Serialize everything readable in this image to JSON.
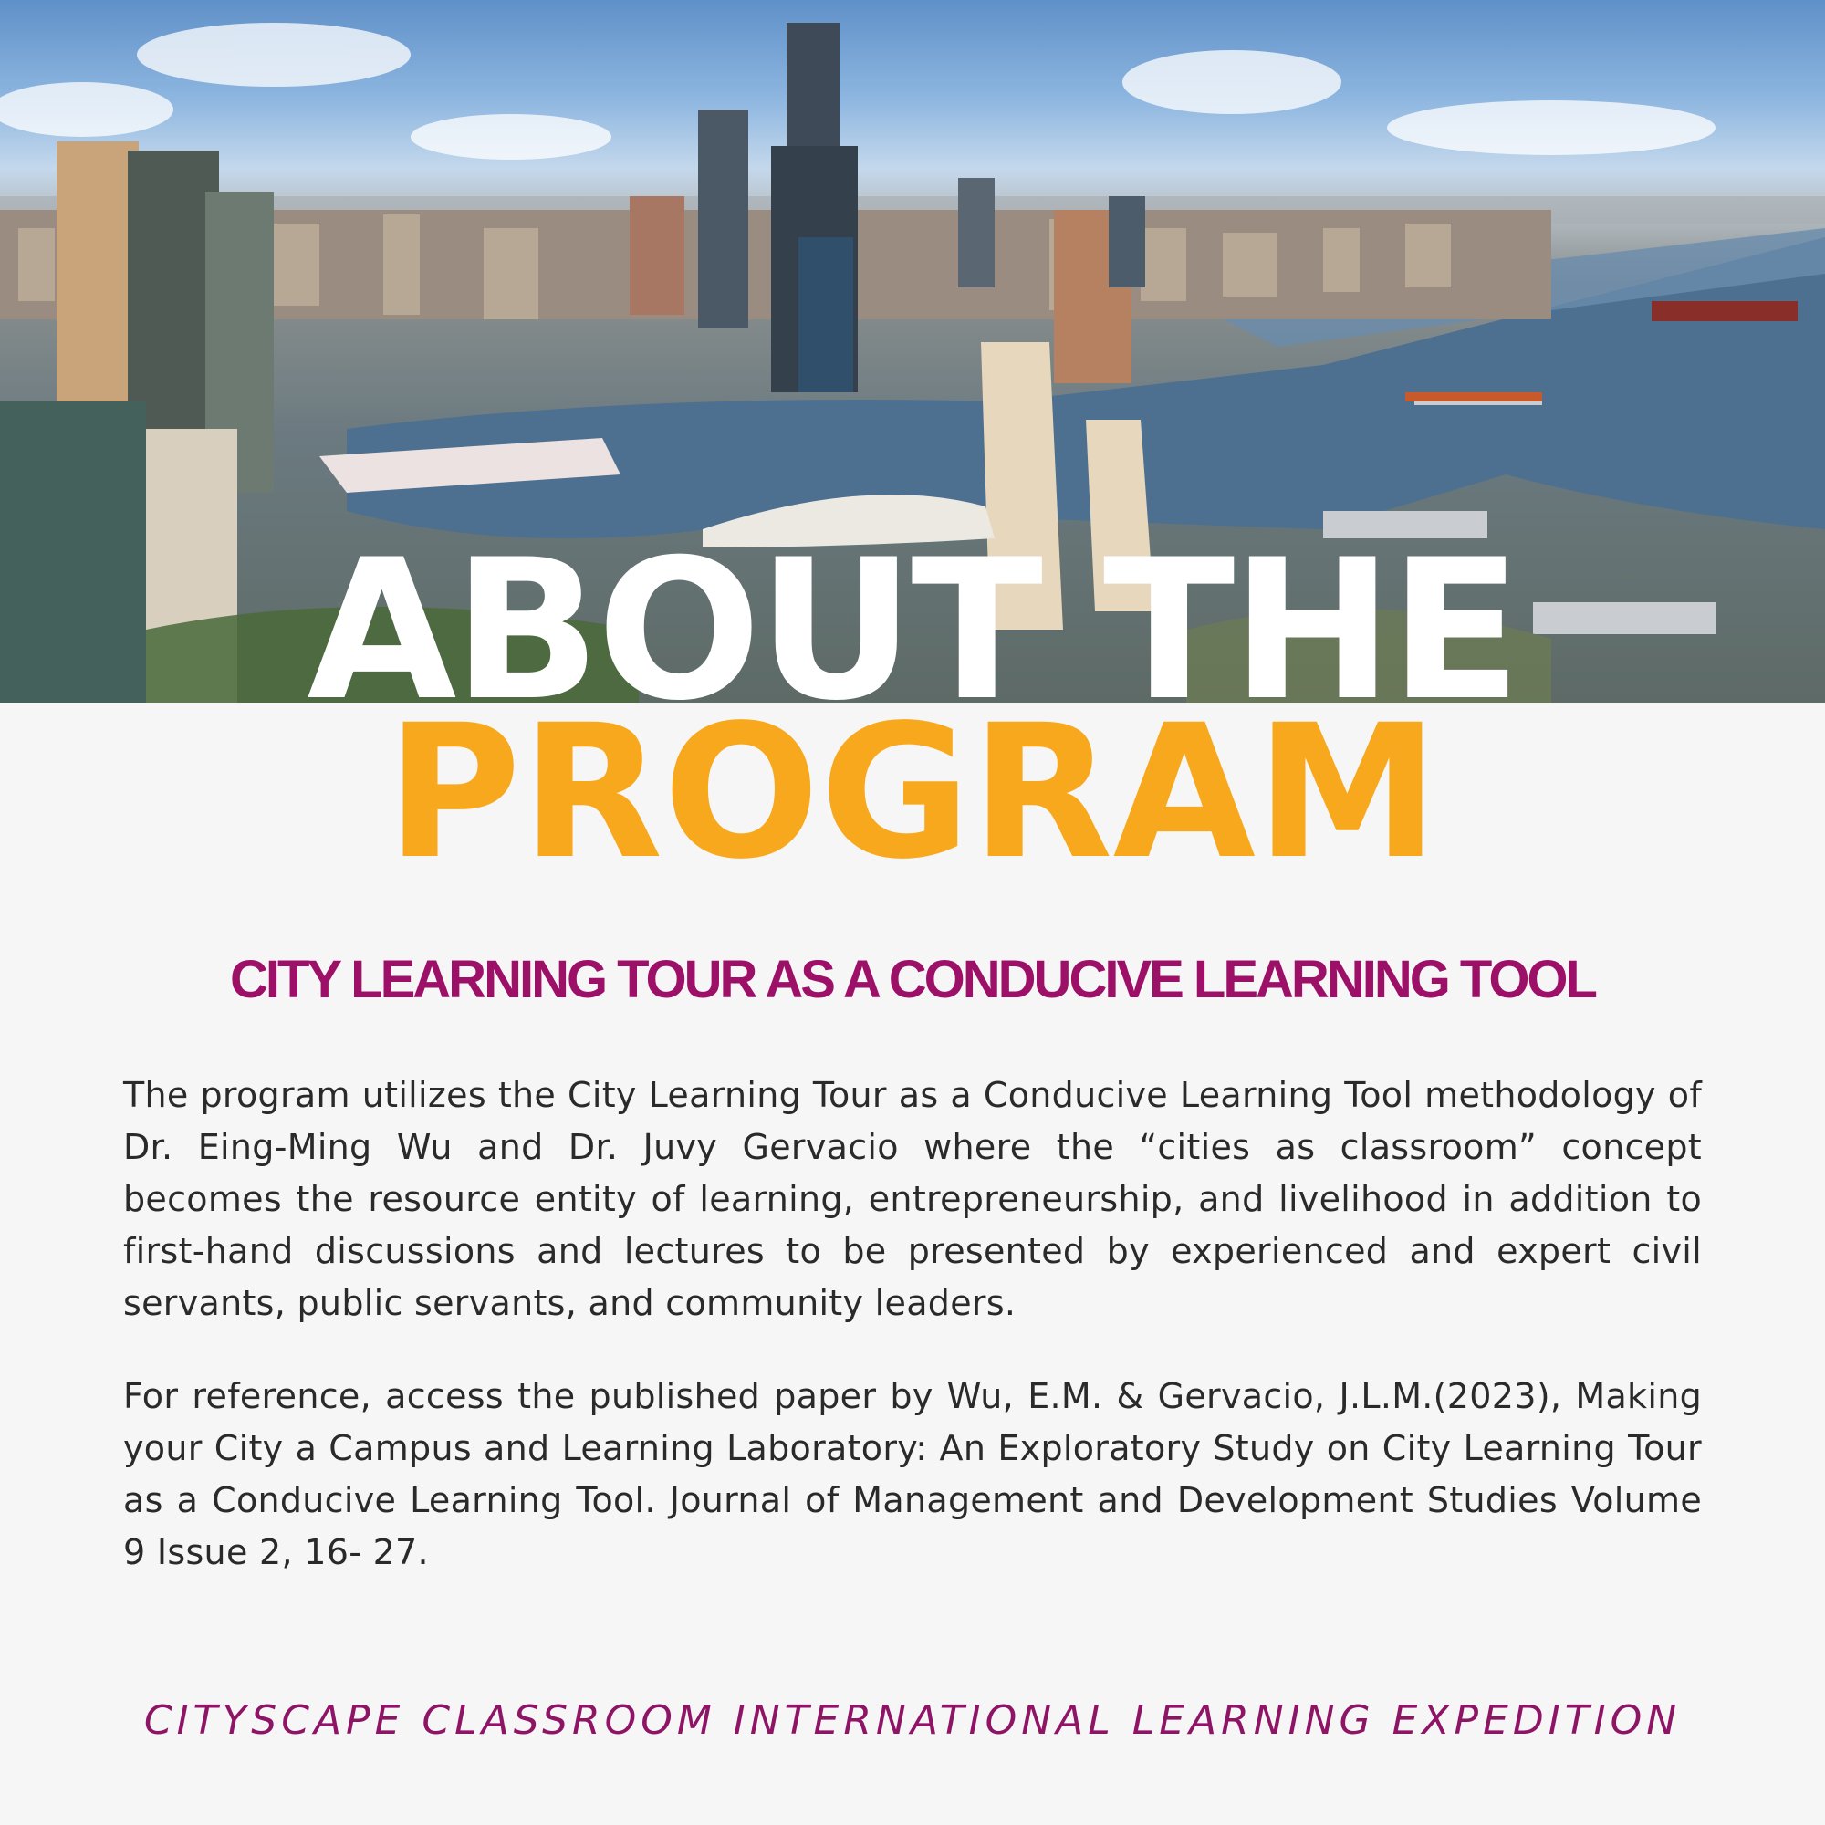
{
  "hero": {
    "image": "city-harbor-skyline-photo"
  },
  "headline": {
    "line1": "ABOUT THE",
    "line2": "PROGRAM"
  },
  "subtitle": "CITY LEARNING TOUR AS A CONDUCIVE LEARNING TOOL",
  "body": {
    "paragraph1": "The program utilizes the City Learning Tour as a Conducive Learning Tool methodology of Dr. Eing-Ming Wu and Dr. Juvy Gervacio where the “cities as classroom” concept becomes the resource entity of learning, entrepreneurship, and livelihood in addition to first-hand discussions and lectures to be presented by experienced and expert civil servants, public servants, and community leaders.",
    "paragraph2": "For reference, access the published paper by Wu, E.M. & Gervacio, J.L.M.(2023), Making your City a Campus and Learning Laboratory: An Exploratory Study on City Learning Tour as a Conducive Learning Tool. Journal of Management and Development Studies Volume 9 Issue 2, 16- 27."
  },
  "footer": "CITYSCAPE CLASSROOM INTERNATIONAL LEARNING EXPEDITION",
  "colors": {
    "accent_orange": "#f8a81c",
    "accent_magenta": "#9c1068",
    "background": "#f6f6f6",
    "body_text": "#2a2a2a"
  }
}
